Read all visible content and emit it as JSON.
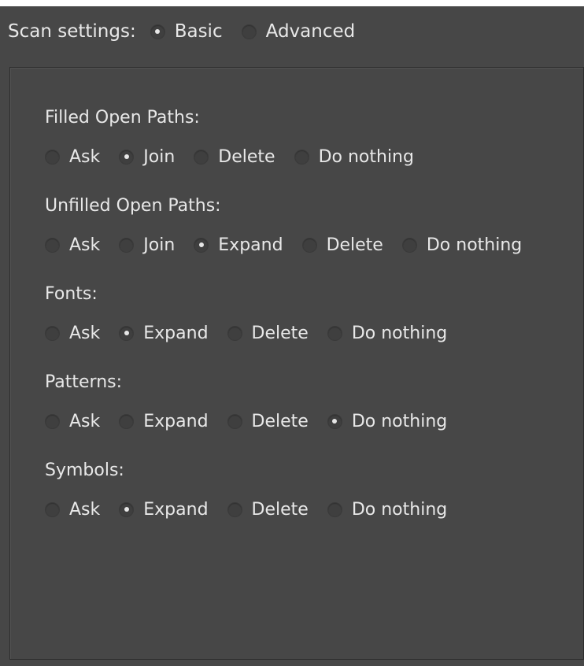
{
  "scan_settings": {
    "label": "Scan settings:",
    "options": [
      {
        "label": "Basic",
        "selected": true
      },
      {
        "label": "Advanced",
        "selected": false
      }
    ]
  },
  "sections": [
    {
      "title": "Filled Open Paths:",
      "options": [
        {
          "label": "Ask",
          "selected": false
        },
        {
          "label": "Join",
          "selected": true
        },
        {
          "label": "Delete",
          "selected": false
        },
        {
          "label": "Do nothing",
          "selected": false
        }
      ]
    },
    {
      "title": "Unfilled Open Paths:",
      "options": [
        {
          "label": "Ask",
          "selected": false
        },
        {
          "label": "Join",
          "selected": false
        },
        {
          "label": "Expand",
          "selected": true
        },
        {
          "label": "Delete",
          "selected": false
        },
        {
          "label": "Do nothing",
          "selected": false
        }
      ]
    },
    {
      "title": "Fonts:",
      "options": [
        {
          "label": "Ask",
          "selected": false
        },
        {
          "label": "Expand",
          "selected": true
        },
        {
          "label": "Delete",
          "selected": false
        },
        {
          "label": "Do nothing",
          "selected": false
        }
      ]
    },
    {
      "title": "Patterns:",
      "options": [
        {
          "label": "Ask",
          "selected": false
        },
        {
          "label": "Expand",
          "selected": false
        },
        {
          "label": "Delete",
          "selected": false
        },
        {
          "label": "Do nothing",
          "selected": true
        }
      ]
    },
    {
      "title": "Symbols:",
      "options": [
        {
          "label": "Ask",
          "selected": false
        },
        {
          "label": "Expand",
          "selected": true
        },
        {
          "label": "Delete",
          "selected": false
        },
        {
          "label": "Do nothing",
          "selected": false
        }
      ]
    }
  ]
}
